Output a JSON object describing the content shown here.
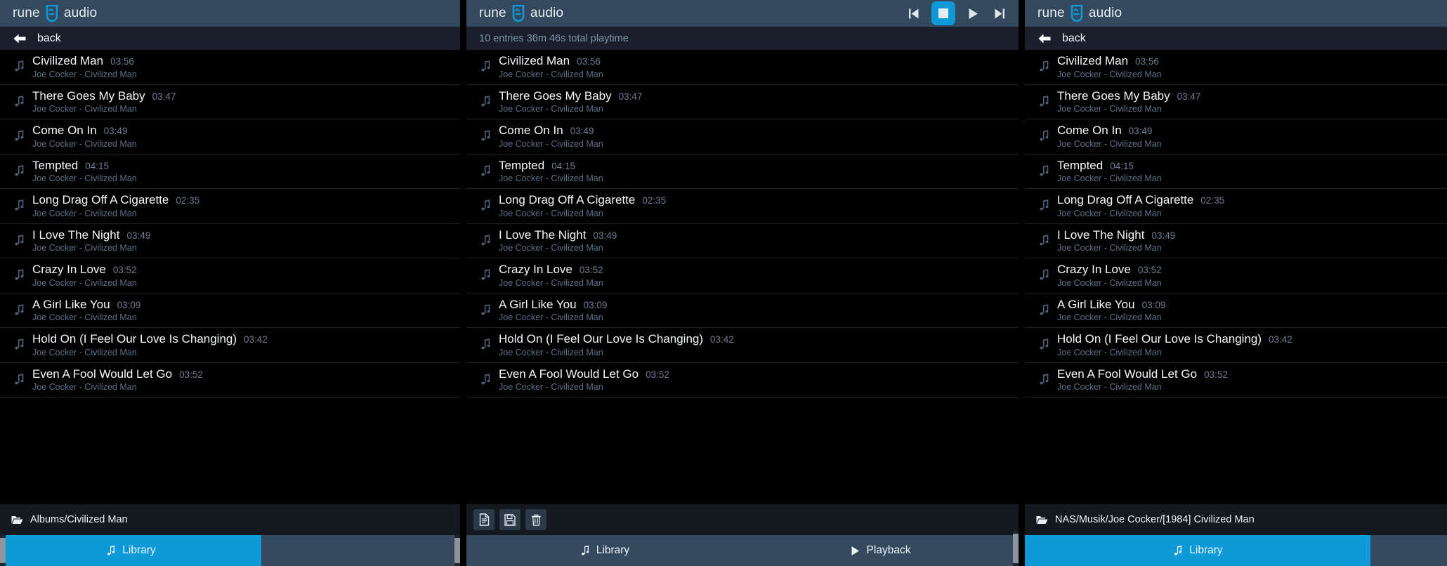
{
  "brand": {
    "left": "rune",
    "right": "audio",
    "logo_icon": "runeaudio-mask-logo"
  },
  "colors": {
    "accent": "#0c9ad8",
    "header_bg": "#34495e",
    "subbar_bg": "#1a1f2b",
    "list_bg": "#000000",
    "footer_bg": "#14181f",
    "title_text": "#f4f7fa",
    "muted_text": "#5c7086"
  },
  "panels": {
    "left": {
      "subbar": {
        "back_label": "back",
        "back_icon": "arrow-left-icon"
      },
      "footer_path": "Albums/Civilized Man",
      "footer_icon": "folder-open-icon",
      "tabs": [
        {
          "label": "Library",
          "icon": "music-note-icon",
          "active": true
        },
        {
          "label": "",
          "icon": "",
          "active": false
        }
      ]
    },
    "middle": {
      "subbar": {
        "entries_label": "10 entries 36m 46s total playtime"
      },
      "transport": [
        {
          "name": "previous",
          "icon": "skip-previous-icon",
          "active": false
        },
        {
          "name": "stop",
          "icon": "stop-icon",
          "active": true
        },
        {
          "name": "play",
          "icon": "play-icon",
          "active": false
        },
        {
          "name": "next",
          "icon": "skip-next-icon",
          "active": false
        }
      ],
      "tools": [
        {
          "name": "new-playlist",
          "icon": "document-icon"
        },
        {
          "name": "save-playlist",
          "icon": "floppy-save-icon"
        },
        {
          "name": "clear-playlist",
          "icon": "trash-icon"
        }
      ],
      "tabs": [
        {
          "label": "Library",
          "icon": "music-note-icon",
          "active": false
        },
        {
          "label": "Playback",
          "icon": "play-icon",
          "active": false
        }
      ]
    },
    "right": {
      "subbar": {
        "back_label": "back",
        "back_icon": "arrow-left-icon"
      },
      "footer_path": "NAS/Musik/Joe Cocker/[1984] Civilized Man",
      "footer_icon": "folder-open-icon",
      "tabs": [
        {
          "label": "Library",
          "icon": "music-note-icon",
          "active": true
        },
        {
          "label": "",
          "icon": "",
          "active": false
        }
      ]
    }
  },
  "tracks": [
    {
      "title": "Civilized Man",
      "time": "03:56",
      "sub": "Joe Cocker - Civilized Man"
    },
    {
      "title": "There Goes My Baby",
      "time": "03:47",
      "sub": "Joe Cocker - Civilized Man"
    },
    {
      "title": "Come On In",
      "time": "03:49",
      "sub": "Joe Cocker - Civilized Man"
    },
    {
      "title": "Tempted",
      "time": "04:15",
      "sub": "Joe Cocker - Civilized Man"
    },
    {
      "title": "Long Drag Off A Cigarette",
      "time": "02:35",
      "sub": "Joe Cocker - Civilized Man"
    },
    {
      "title": "I Love The Night",
      "time": "03:49",
      "sub": "Joe Cocker - Civilized Man"
    },
    {
      "title": "Crazy In Love",
      "time": "03:52",
      "sub": "Joe Cocker - Civilized Man"
    },
    {
      "title": "A Girl Like You",
      "time": "03:09",
      "sub": "Joe Cocker - Civilized Man"
    },
    {
      "title": "Hold On (I Feel Our Love Is Changing)",
      "time": "03:42",
      "sub": "Joe Cocker - Civilized Man"
    },
    {
      "title": "Even A Fool Would Let Go",
      "time": "03:52",
      "sub": "Joe Cocker - Civilized Man"
    }
  ]
}
